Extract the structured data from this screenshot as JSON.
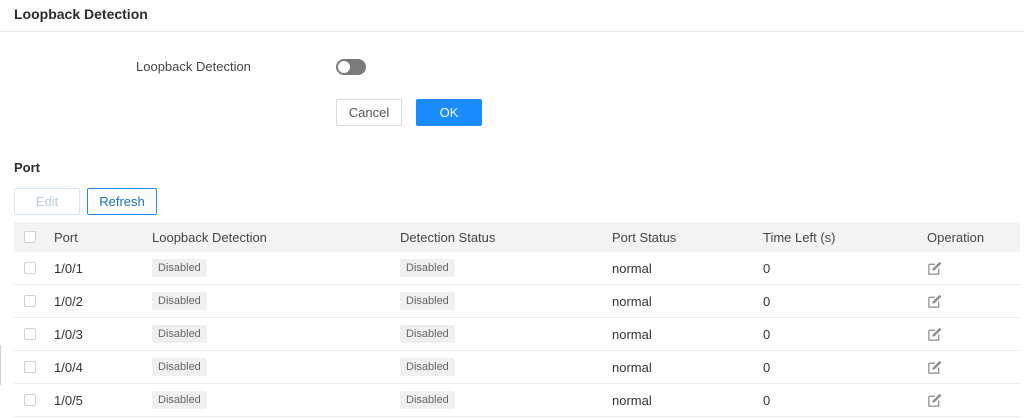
{
  "page": {
    "title": "Loopback Detection"
  },
  "form": {
    "label": "Loopback Detection",
    "toggle_state": "off",
    "cancel_label": "Cancel",
    "ok_label": "OK"
  },
  "port_section": {
    "title": "Port",
    "edit_label": "Edit",
    "refresh_label": "Refresh"
  },
  "table": {
    "headers": {
      "port": "Port",
      "loopback": "Loopback Detection",
      "detection_status": "Detection Status",
      "port_status": "Port Status",
      "time_left": "Time Left (s)",
      "operation": "Operation"
    },
    "rows": [
      {
        "port": "1/0/1",
        "loopback": "Disabled",
        "detection_status": "Disabled",
        "port_status": "normal",
        "time_left": "0"
      },
      {
        "port": "1/0/2",
        "loopback": "Disabled",
        "detection_status": "Disabled",
        "port_status": "normal",
        "time_left": "0"
      },
      {
        "port": "1/0/3",
        "loopback": "Disabled",
        "detection_status": "Disabled",
        "port_status": "normal",
        "time_left": "0"
      },
      {
        "port": "1/0/4",
        "loopback": "Disabled",
        "detection_status": "Disabled",
        "port_status": "normal",
        "time_left": "0"
      },
      {
        "port": "1/0/5",
        "loopback": "Disabled",
        "detection_status": "Disabled",
        "port_status": "normal",
        "time_left": "0"
      }
    ]
  },
  "icons": {
    "row_operation": "edit-icon"
  },
  "colors": {
    "primary": "#1a8cff",
    "toggle_off": "#7a7a7a",
    "header_bg": "#f3f3f3"
  }
}
